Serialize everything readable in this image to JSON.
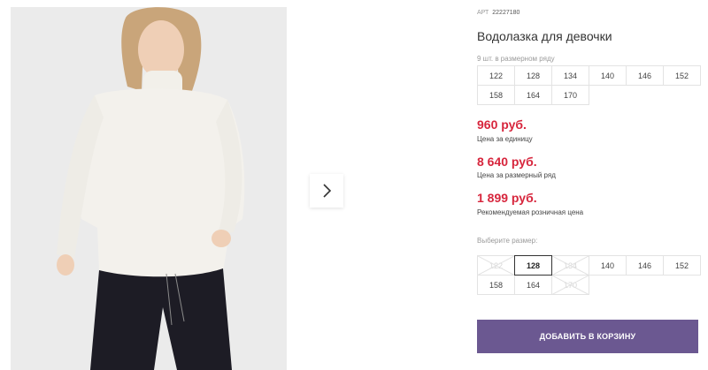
{
  "product": {
    "sku_label": "АРТ",
    "sku_value": "22227180",
    "title": "Водолазка для девочки",
    "image_alt": "product-photo-girl-white-turtleneck"
  },
  "size_range": {
    "label": "9 шт. в размерном ряду",
    "sizes": [
      "122",
      "128",
      "134",
      "140",
      "146",
      "152",
      "158",
      "164",
      "170"
    ]
  },
  "prices": [
    {
      "value": "960 руб.",
      "note": "Цена за единицу"
    },
    {
      "value": "8 640 руб.",
      "note": "Цена за размерный ряд"
    },
    {
      "value": "1 899 руб.",
      "note": "Рекомендуемая розничная цена"
    }
  ],
  "size_select": {
    "label": "Выберите размер:",
    "options": [
      {
        "size": "122",
        "state": "disabled"
      },
      {
        "size": "128",
        "state": "selected"
      },
      {
        "size": "134",
        "state": "disabled"
      },
      {
        "size": "140",
        "state": "available"
      },
      {
        "size": "146",
        "state": "available"
      },
      {
        "size": "152",
        "state": "available"
      },
      {
        "size": "158",
        "state": "available"
      },
      {
        "size": "164",
        "state": "available"
      },
      {
        "size": "170",
        "state": "disabled"
      }
    ]
  },
  "cart_button": {
    "label": "ДОБАВИТЬ В КОРЗИНУ"
  },
  "colors": {
    "price": "#d7263d",
    "button": "#6b5891",
    "sweater": "#f3f1ec",
    "pants": "#1d1c25"
  },
  "icons": {
    "next": "chevron-right-icon",
    "photo": "product-photo"
  }
}
